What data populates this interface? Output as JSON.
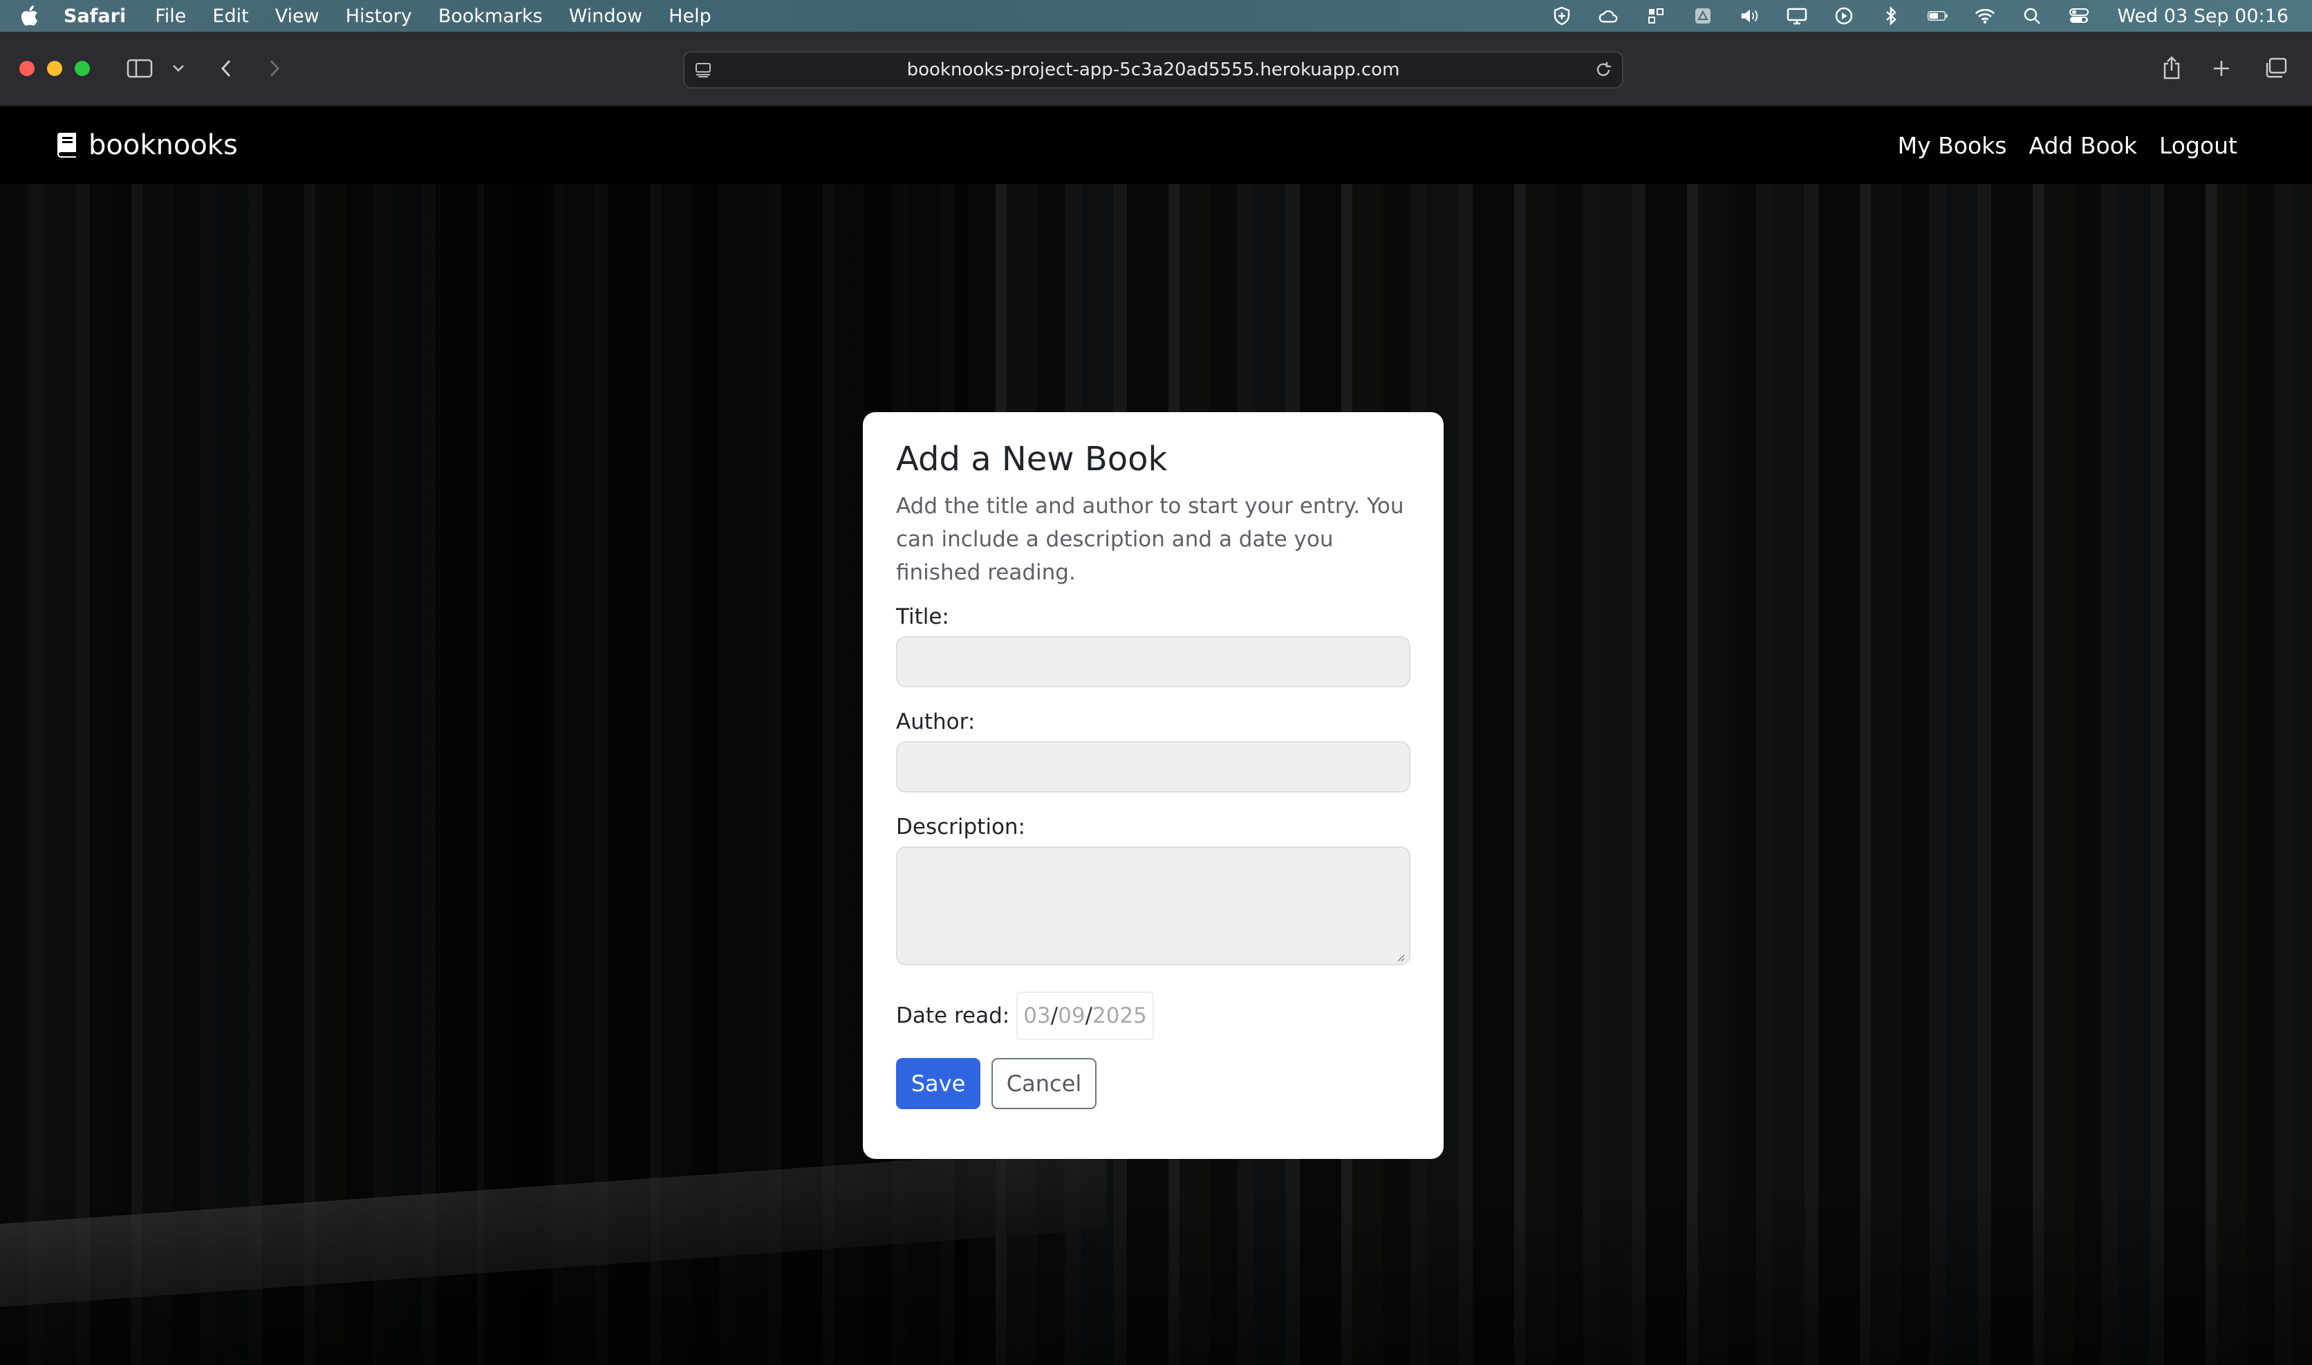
{
  "menubar": {
    "app": "Safari",
    "items": [
      "File",
      "Edit",
      "View",
      "History",
      "Bookmarks",
      "Window",
      "Help"
    ],
    "clock": "Wed 03 Sep  00:16"
  },
  "browser": {
    "url": "booknooks-project-app-5c3a20ad5555.herokuapp.com"
  },
  "navbar": {
    "brand": "booknooks",
    "links": [
      "My Books",
      "Add Book",
      "Logout"
    ]
  },
  "form": {
    "title": "Add a New Book",
    "intro": "Add the title and author to start your entry. You can include a description and a date you finished reading.",
    "title_label": "Title:",
    "author_label": "Author:",
    "description_label": "Description:",
    "date_label": "Date read:",
    "date": {
      "day": "03",
      "month": "09",
      "year": "2025",
      "separator": "/"
    },
    "save_label": "Save",
    "cancel_label": "Cancel"
  },
  "colors": {
    "primary": "#2f66e0",
    "navbar": "#000000",
    "menubar": "#4a6b78"
  }
}
